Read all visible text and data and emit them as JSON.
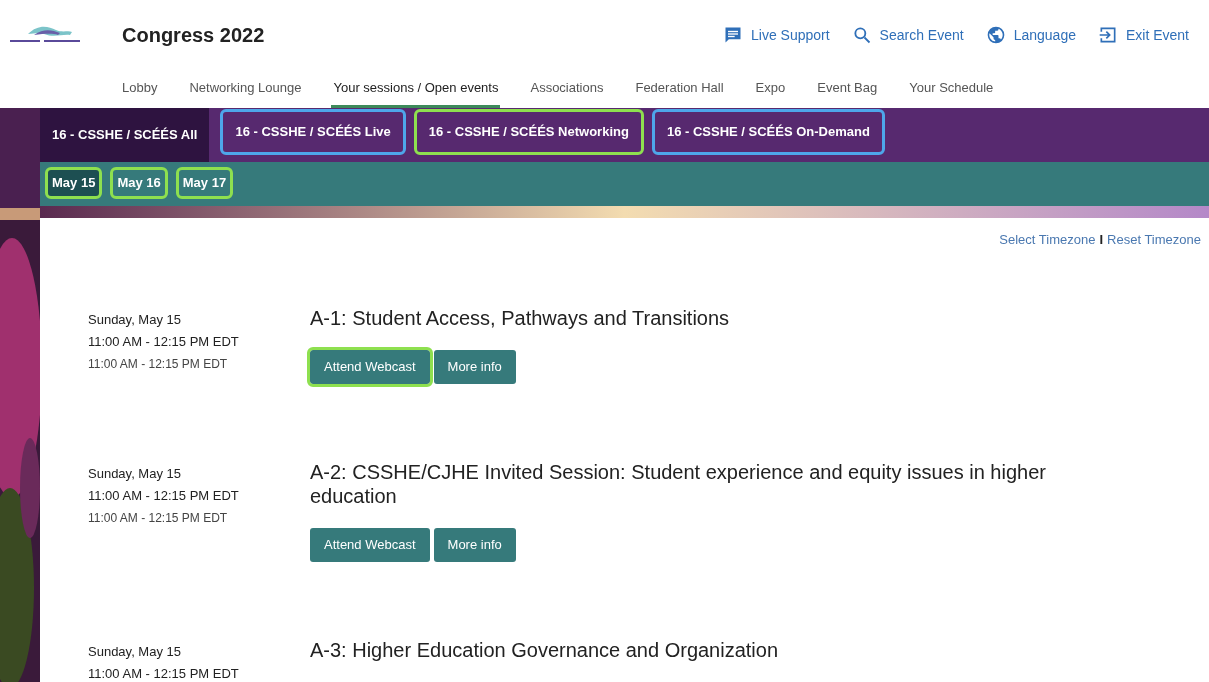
{
  "header": {
    "title": "Congress 2022",
    "actions": [
      {
        "kind": "chat",
        "label": "Live Support"
      },
      {
        "kind": "search",
        "label": "Search Event"
      },
      {
        "kind": "globe",
        "label": "Language"
      },
      {
        "kind": "exit",
        "label": "Exit Event"
      }
    ]
  },
  "nav": [
    {
      "label": "Lobby",
      "selected": false
    },
    {
      "label": "Networking Lounge",
      "selected": false
    },
    {
      "label": "Your sessions / Open events",
      "selected": true
    },
    {
      "label": "Associations",
      "selected": false
    },
    {
      "label": "Federation Hall",
      "selected": false
    },
    {
      "label": "Expo",
      "selected": false
    },
    {
      "label": "Event Bag",
      "selected": false
    },
    {
      "label": "Your Schedule",
      "selected": false
    }
  ],
  "stream_tabs": [
    {
      "label": "16 - CSSHE / SCÉÉS All",
      "selected": true
    },
    {
      "label": "16 - CSSHE / SCÉÉS Live",
      "selected": false,
      "color": "#4ea6ea"
    },
    {
      "label": "16 - CSSHE / SCÉÉS Networking",
      "selected": false,
      "color": "#8ee04f"
    },
    {
      "label": "16 - CSSHE / SCÉÉS On-Demand",
      "selected": false,
      "color": "#4ea6ea"
    }
  ],
  "date_tabs": [
    {
      "label": "May 15",
      "selected": true,
      "color": "#8ee04f"
    },
    {
      "label": "May 16",
      "selected": false,
      "color": "#8ee04f"
    },
    {
      "label": "May 17",
      "selected": false,
      "color": "#8ee04f"
    }
  ],
  "timezone": {
    "select": "Select Timezone",
    "separator": "I",
    "reset": "Reset Timezone"
  },
  "sessions": [
    {
      "date": "Sunday, May 15",
      "time": "11:00 AM - 12:15 PM EDT",
      "local_time": "11:00 AM - 12:15 PM EDT",
      "title": "A-1: Student Access, Pathways and Transitions",
      "buttons": [
        {
          "label": "Attend Webcast",
          "color": "#8ee04f"
        },
        {
          "label": "More info"
        }
      ]
    },
    {
      "date": "Sunday, May 15",
      "time": "11:00 AM - 12:15 PM EDT",
      "local_time": "11:00 AM - 12:15 PM EDT",
      "title": "A-2: CSSHE/CJHE Invited Session: Student experience and equity issues in higher education",
      "buttons": [
        {
          "label": "Attend Webcast"
        },
        {
          "label": "More info"
        }
      ]
    },
    {
      "date": "Sunday, May 15",
      "time": "11:00 AM - 12:15 PM EDT",
      "title": "A-3: Higher Education Governance and Organization"
    }
  ]
}
